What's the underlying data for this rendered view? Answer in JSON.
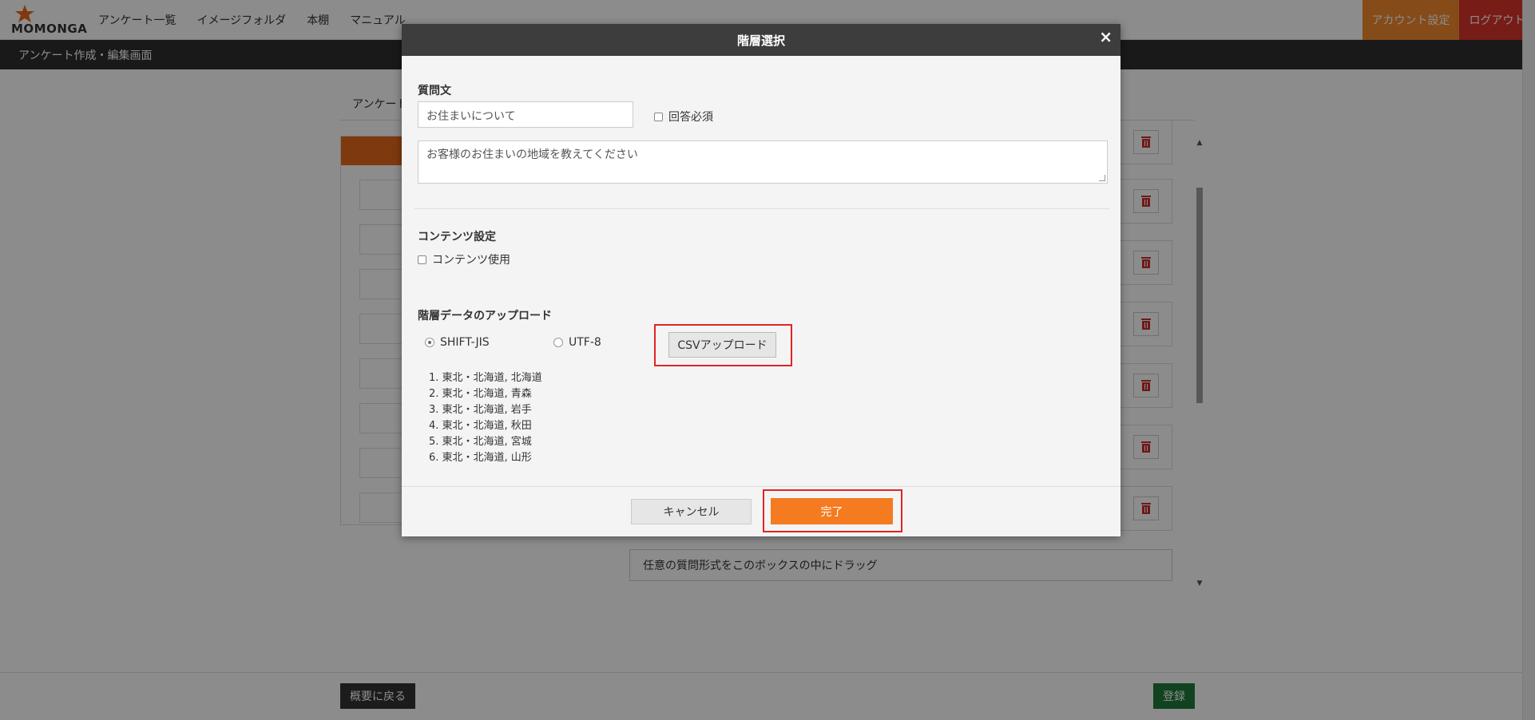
{
  "topnav": {
    "logo_text": "MOMONGA",
    "items": [
      "アンケート一覧",
      "イメージフォルダ",
      "本棚",
      "マニュアル"
    ],
    "account_label": "アカウント設定",
    "logout_label": "ログアウト"
  },
  "subbar": {
    "title": "アンケート作成・編集画面"
  },
  "content": {
    "tab_label": "アンケート",
    "drag_hint": "任意の質問形式をこのボックスの中にドラッグ"
  },
  "footer": {
    "back_label": "概要に戻る",
    "register_label": "登録"
  },
  "modal": {
    "title": "階層選択",
    "close_glyph": "×",
    "question_label": "質問文",
    "question_value": "お住まいについて",
    "required_label": "回答必須",
    "description_value": "お客様のお住まいの地域を教えてください",
    "contents_label": "コンテンツ設定",
    "contents_use_label": "コンテンツ使用",
    "upload_label": "階層データのアップロード",
    "encodings": [
      {
        "label": "SHIFT-JIS",
        "selected": true
      },
      {
        "label": "UTF-8",
        "selected": false
      }
    ],
    "csv_button_label": "CSVアップロード",
    "data_rows": [
      "1. 東北・北海道, 北海道",
      "2. 東北・北海道, 青森",
      "3. 東北・北海道, 岩手",
      "4. 東北・北海道, 秋田",
      "5. 東北・北海道, 宮城",
      "6. 東北・北海道, 山形"
    ],
    "cancel_label": "キャンセル",
    "done_label": "完了"
  },
  "colors": {
    "accent_orange": "#f47b20",
    "logout_red": "#d9342b",
    "register_green": "#1f7a3c",
    "highlight_red": "#e02424"
  },
  "icons": [
    "star-logo-icon",
    "close-icon",
    "trash-icon",
    "checkbox-icon",
    "radio-icon",
    "scroll-up-icon",
    "scroll-down-icon"
  ]
}
